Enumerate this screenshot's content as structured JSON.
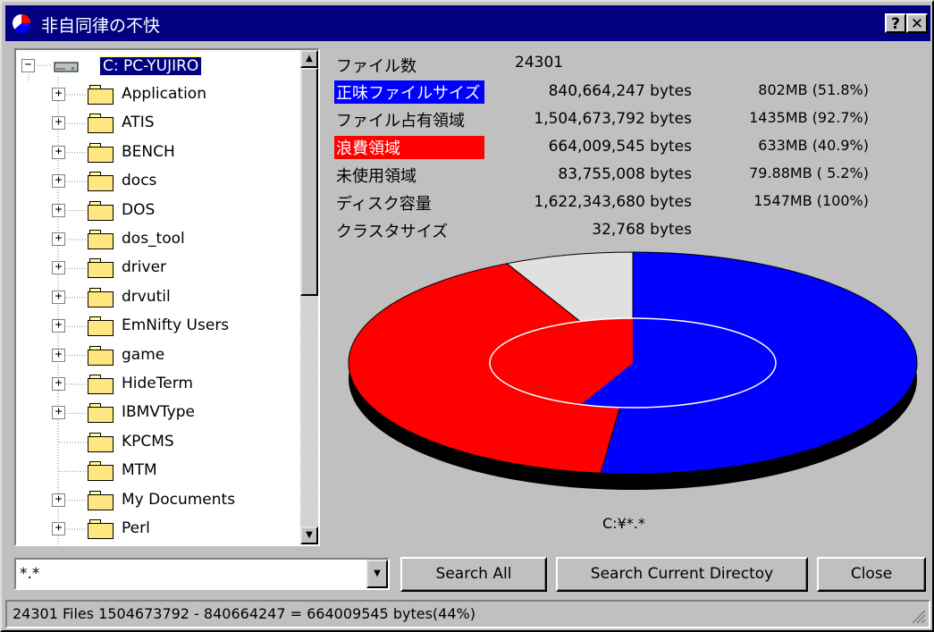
{
  "window": {
    "title": "非自同律の不快",
    "help_label": "?",
    "close_label": "✕"
  },
  "tree": {
    "root_label": "C: PC-YUJIRO",
    "items": [
      {
        "label": "Application",
        "expandable": true
      },
      {
        "label": "ATIS",
        "expandable": true
      },
      {
        "label": "BENCH",
        "expandable": true
      },
      {
        "label": "docs",
        "expandable": true
      },
      {
        "label": "DOS",
        "expandable": true
      },
      {
        "label": "dos_tool",
        "expandable": true
      },
      {
        "label": "driver",
        "expandable": true
      },
      {
        "label": "drvutil",
        "expandable": true
      },
      {
        "label": "EmNifty Users",
        "expandable": true
      },
      {
        "label": "game",
        "expandable": true
      },
      {
        "label": "HideTerm",
        "expandable": true
      },
      {
        "label": "IBMVType",
        "expandable": true
      },
      {
        "label": "KPCMS",
        "expandable": false
      },
      {
        "label": "MTM",
        "expandable": false
      },
      {
        "label": "My Documents",
        "expandable": true
      },
      {
        "label": "Perl",
        "expandable": true
      }
    ],
    "expander_plus": "+",
    "expander_minus": "−"
  },
  "stats": {
    "file_count_label": "ファイル数",
    "file_count_value": "24301",
    "rows": [
      {
        "label": "正味ファイルサイズ",
        "bytes": "840,664,247 bytes",
        "mb": "802MB (51.8%)",
        "highlight": "#0000ff"
      },
      {
        "label": "ファイル占有領域",
        "bytes": "1,504,673,792 bytes",
        "mb": "1435MB (92.7%)",
        "highlight": ""
      },
      {
        "label": "浪費領域",
        "bytes": "664,009,545 bytes",
        "mb": "633MB (40.9%)",
        "highlight": "#ff0000"
      },
      {
        "label": "未使用領域",
        "bytes": "83,755,008 bytes",
        "mb": "79.88MB ( 5.2%)",
        "highlight": ""
      },
      {
        "label": "ディスク容量",
        "bytes": "1,622,343,680 bytes",
        "mb": "1547MB (100%)",
        "highlight": ""
      },
      {
        "label": "クラスタサイズ",
        "bytes": "32,768 bytes",
        "mb": "",
        "highlight": ""
      }
    ]
  },
  "chart_data": {
    "type": "pie",
    "outer_ring": [
      {
        "label": "正味ファイルサイズ",
        "percent": 51.8,
        "color": "#0000ff"
      },
      {
        "label": "浪費領域",
        "percent": 40.9,
        "color": "#ff0000"
      },
      {
        "label": "未使用領域",
        "percent": 7.3,
        "color": "#e0e0e0"
      }
    ],
    "inner_ellipse": [
      {
        "label": "正味ファイルサイズ",
        "percent": 55.9,
        "color": "#0000ff"
      },
      {
        "label": "浪費領域",
        "percent": 44.1,
        "color": "#ff0000"
      }
    ],
    "caption": "C:¥*.*"
  },
  "search": {
    "pattern_value": "*.*",
    "search_all_label": "Search All",
    "search_current_label": "Search Current Directoy",
    "close_label": "Close"
  },
  "status": {
    "text": "24301 Files  1504673792 - 840664247 = 664009545 bytes(44%)"
  },
  "colors": {
    "title_bar": "#000080",
    "face": "#c0c0c0",
    "net_size": "#0000ff",
    "wasted": "#ff0000",
    "unused": "#e0e0e0"
  }
}
